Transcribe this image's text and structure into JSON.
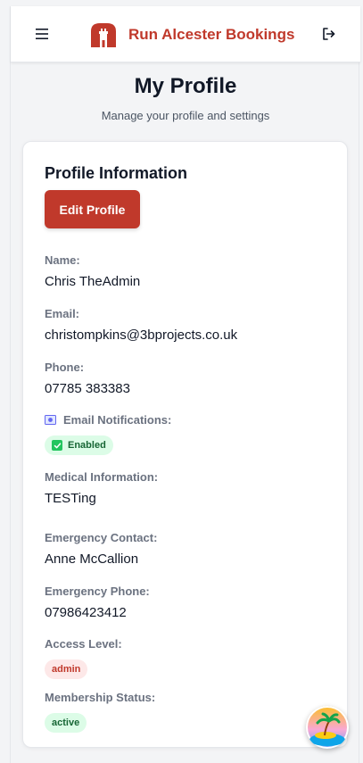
{
  "header": {
    "app_name": "Run Alcester Bookings"
  },
  "page": {
    "title": "My Profile",
    "subtitle": "Manage your profile and settings"
  },
  "profile": {
    "section_title": "Profile Information",
    "edit_label": "Edit Profile",
    "fields": {
      "name": {
        "label": "Name:",
        "value": "Chris TheAdmin"
      },
      "email": {
        "label": "Email:",
        "value": "christompkins@3bprojects.co.uk"
      },
      "phone": {
        "label": "Phone:",
        "value": "07785 383383"
      },
      "notifications": {
        "label": "Email Notifications:",
        "value": "Enabled"
      },
      "medical": {
        "label": "Medical Information:",
        "value": "TESTing"
      },
      "emergency_contact": {
        "label": "Emergency Contact:",
        "value": "Anne McCallion"
      },
      "emergency_phone": {
        "label": "Emergency Phone:",
        "value": "07986423412"
      },
      "access_level": {
        "label": "Access Level:",
        "value": "admin"
      },
      "membership": {
        "label": "Membership Status:",
        "value": "active"
      }
    }
  },
  "icons": {
    "menu": "hamburger-menu-icon",
    "logo": "castle-logo-icon",
    "logout": "logout-icon",
    "notifications": "envelope-icon",
    "enabled": "checkmark-icon",
    "fab": "beach-island-icon"
  },
  "colors": {
    "brand": "#c0392b",
    "success_bg": "#dcfce7",
    "success_text": "#166534",
    "admin_bg": "#fde8e8"
  }
}
